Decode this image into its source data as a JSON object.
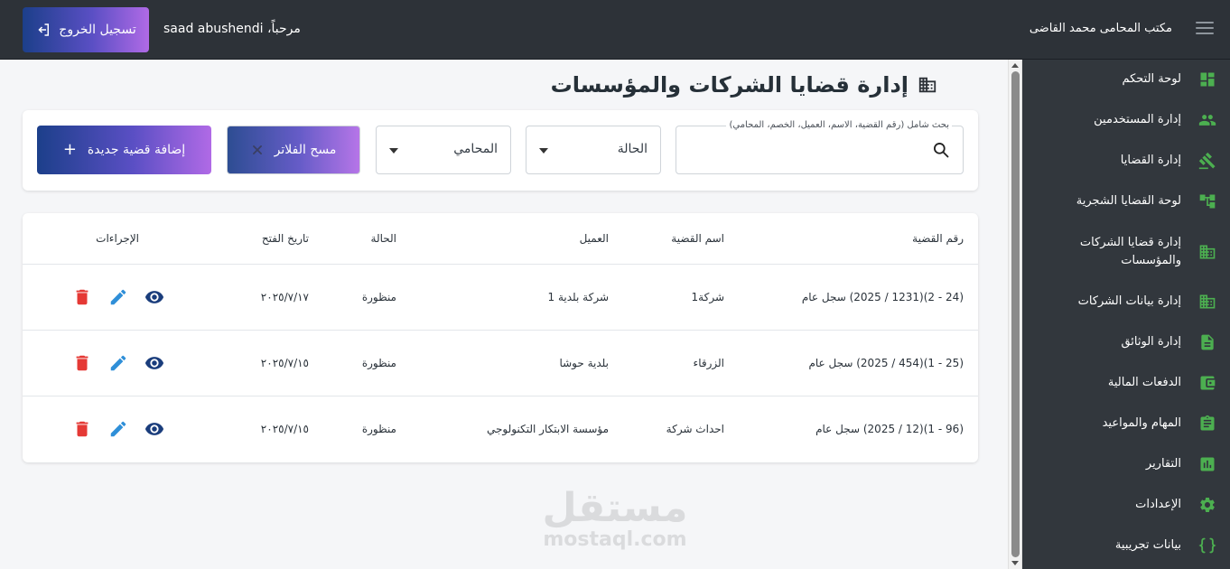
{
  "header": {
    "app_title": "مكتب المحامى محمد القاضى",
    "welcome": "مرحباً، saad abushendi",
    "logout_label": "تسجيل الخروج"
  },
  "sidebar": {
    "items": [
      {
        "label": "لوحة التحكم",
        "icon": "dashboard-icon"
      },
      {
        "label": "إدارة المستخدمين",
        "icon": "users-icon"
      },
      {
        "label": "إدارة القضايا",
        "icon": "gavel-icon"
      },
      {
        "label": "لوحة القضايا الشجرية",
        "icon": "tree-icon"
      },
      {
        "label": "إدارة قضايا الشركات والمؤسسات",
        "icon": "building-icon"
      },
      {
        "label": "إدارة بيانات الشركات",
        "icon": "building-icon"
      },
      {
        "label": "إدارة الوثائق",
        "icon": "document-icon"
      },
      {
        "label": "الدفعات المالية",
        "icon": "wallet-icon"
      },
      {
        "label": "المهام والمواعيد",
        "icon": "clipboard-icon"
      },
      {
        "label": "التقارير",
        "icon": "chart-icon"
      },
      {
        "label": "الإعدادات",
        "icon": "gear-icon"
      },
      {
        "label": "بيانات تجريبية",
        "icon": "braces-icon"
      }
    ]
  },
  "page": {
    "title": "إدارة قضايا الشركات والمؤسسات"
  },
  "filters": {
    "search_label": "بحث شامل (رقم القضية، الاسم، العميل، الخصم، المحامي)",
    "search_value": "",
    "status_label": "الحالة",
    "lawyer_label": "المحامي",
    "clear_label": "مسح الفلاتر",
    "add_label": "إضافة قضية جديدة"
  },
  "table": {
    "headers": {
      "case_number": "رقم القضية",
      "case_name": "اسم القضية",
      "client": "العميل",
      "status": "الحالة",
      "open_date": "تاريخ الفتح",
      "actions": "الإجراءات"
    },
    "rows": [
      {
        "case_number": "(24 - 2)(1231 / 2025) سجل عام",
        "case_name": "شركة1",
        "client": "شركة بلدية 1",
        "status": "منظورة",
        "open_date": "٢٠٢٥/٧/١٧"
      },
      {
        "case_number": "(25 - 1)(454 / 2025) سجل عام",
        "case_name": "الزرقاء",
        "client": "بلدية حوشا",
        "status": "منظورة",
        "open_date": "٢٠٢٥/٧/١٥"
      },
      {
        "case_number": "(96 - 1)(12 / 2025) سجل عام",
        "case_name": "احداث شركة",
        "client": "مؤسسة الابتكار التكنولوجي",
        "status": "منظورة",
        "open_date": "٢٠٢٥/٧/١٥"
      }
    ]
  },
  "watermark": {
    "arabic": "مستقل",
    "latin": "mostaql.com"
  },
  "colors": {
    "sidebar_icon": "#4caf50",
    "view_icon": "#1a3d7c",
    "edit_icon": "#2f8fd8",
    "delete_icon": "#e53935",
    "topbar_bg": "#2d3238",
    "sidebar_bg": "#32373d"
  }
}
